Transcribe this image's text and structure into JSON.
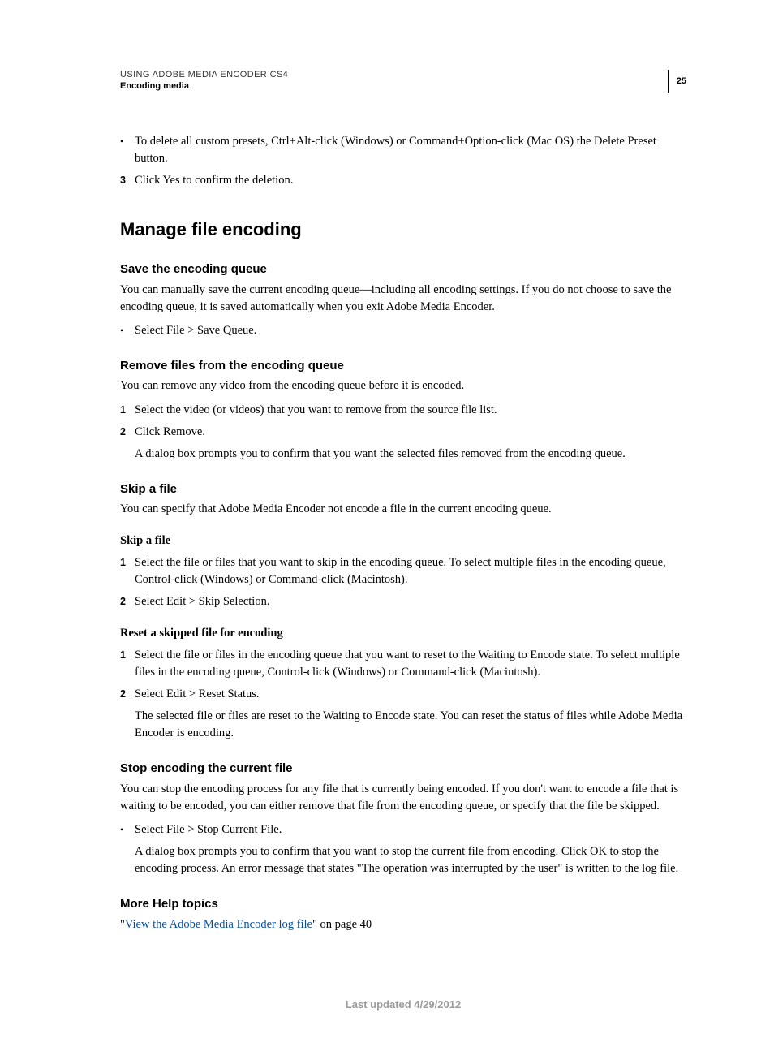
{
  "header": {
    "title": "USING ADOBE MEDIA ENCODER CS4",
    "section": "Encoding media",
    "page_number": "25"
  },
  "intro": {
    "bullet": "To delete all custom presets, Ctrl+Alt-click (Windows) or Command+Option-click (Mac OS) the Delete Preset button.",
    "step3_num": "3",
    "step3_text": "Click Yes to confirm the deletion."
  },
  "h1": "Manage file encoding",
  "save_queue": {
    "heading": "Save the encoding queue",
    "para": "You can manually save the current encoding queue—including all encoding settings. If you do not choose to save the encoding queue, it is saved automatically when you exit Adobe Media Encoder.",
    "bullet": "Select File > Save Queue."
  },
  "remove_files": {
    "heading": "Remove files from the encoding queue",
    "para": "You can remove any video from the encoding queue before it is encoded.",
    "step1_num": "1",
    "step1_text": "Select the video (or videos) that you want to remove from the source file list.",
    "step2_num": "2",
    "step2_text": "Click Remove.",
    "step2_follow": "A dialog box prompts you to confirm that you want the selected files removed from the encoding queue."
  },
  "skip_file": {
    "heading": "Skip a file",
    "para": "You can specify that Adobe Media Encoder not encode a file in the current encoding queue.",
    "mini1": "Skip a file",
    "s1_num": "1",
    "s1_text": "Select the file or files that you want to skip in the encoding queue. To select multiple files in the encoding queue, Control-click (Windows) or Command-click (Macintosh).",
    "s2_num": "2",
    "s2_text": "Select Edit > Skip Selection.",
    "mini2": "Reset a skipped file for encoding",
    "r1_num": "1",
    "r1_text": "Select the file or files in the encoding queue that you want to reset to the Waiting to Encode state. To select multiple files in the encoding queue, Control-click (Windows) or Command-click (Macintosh).",
    "r2_num": "2",
    "r2_text": "Select Edit > Reset Status.",
    "r2_follow": "The selected file or files are reset to the Waiting to Encode state. You can reset the status of files while Adobe Media Encoder is encoding."
  },
  "stop_encoding": {
    "heading": "Stop encoding the current file",
    "para": "You can stop the encoding process for any file that is currently being encoded. If you don't want to encode a file that is waiting to be encoded, you can either remove that file from the encoding queue, or specify that the file be skipped.",
    "bullet": "Select File > Stop Current File.",
    "bullet_follow": "A dialog box prompts you to confirm that you want to stop the current file from encoding. Click OK to stop the encoding process. An error message that states \"The operation was interrupted by the user\" is written to the log file."
  },
  "more_help": {
    "heading": "More Help topics",
    "quote_open": "\"",
    "link_text": "View the Adobe Media Encoder log file",
    "quote_close": "\" on page 40"
  },
  "footer": "Last updated 4/29/2012"
}
